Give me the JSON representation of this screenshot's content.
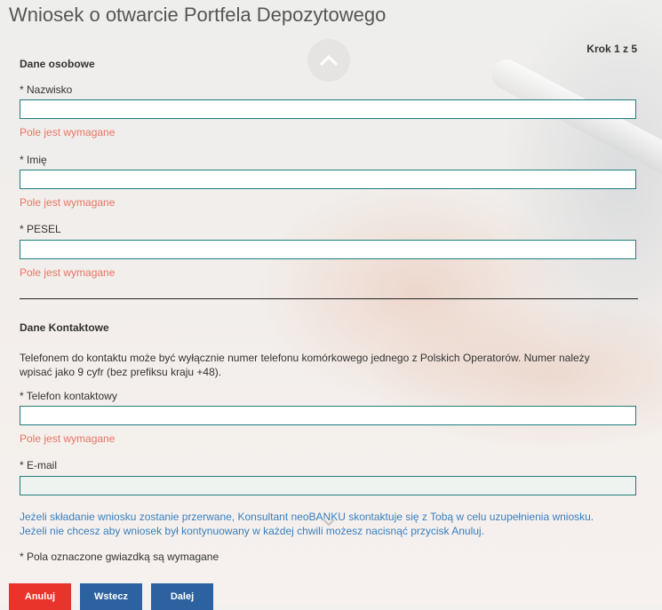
{
  "page": {
    "title": "Wniosek o otwarcie Portfela Depozytowego",
    "step": "Krok 1 z 5"
  },
  "personal": {
    "heading": "Dane osobowe",
    "surname": {
      "label": "* Nazwisko",
      "value": "",
      "error": "Pole jest wymagane"
    },
    "first_name": {
      "label": "* Imię",
      "value": "",
      "error": "Pole jest wymagane"
    },
    "pesel": {
      "label": "* PESEL",
      "value": "",
      "error": "Pole jest wymagane"
    }
  },
  "contact": {
    "heading": "Dane Kontaktowe",
    "phone_info_line1": "Telefonem do kontaktu może być wyłącznie numer telefonu komórkowego jednego z Polskich Operatorów. Numer należy",
    "phone_info_line2": "wpisać jako 9 cyfr (bez prefiksu kraju +48).",
    "phone": {
      "label": "* Telefon kontaktowy",
      "value": "",
      "error": "Pole jest wymagane"
    },
    "email": {
      "label": "* E-mail",
      "value": ""
    }
  },
  "notice": {
    "line1": "Jeżeli składanie wniosku zostanie przerwane, Konsultant neoBANKU skontaktuje się z Tobą w celu uzupełnienia wniosku.",
    "line2": "Jeżeli nie chcesz aby wniosek był kontynuowany w każdej chwili możesz nacisnąć przycisk Anuluj."
  },
  "required_note": "* Pola oznaczone gwiazdką są wymagane",
  "buttons": {
    "cancel": "Anuluj",
    "back": "Wstecz",
    "next": "Dalej"
  },
  "colors": {
    "error": "#e87565",
    "link_text": "#3a7fbd",
    "input_border": "#1e7d7a",
    "cancel_button": "#e8342b",
    "nav_button": "#2c62a0"
  },
  "icons": {
    "scroll_up": "chevron-up-icon",
    "scroll_down": "chevron-down-icon"
  }
}
